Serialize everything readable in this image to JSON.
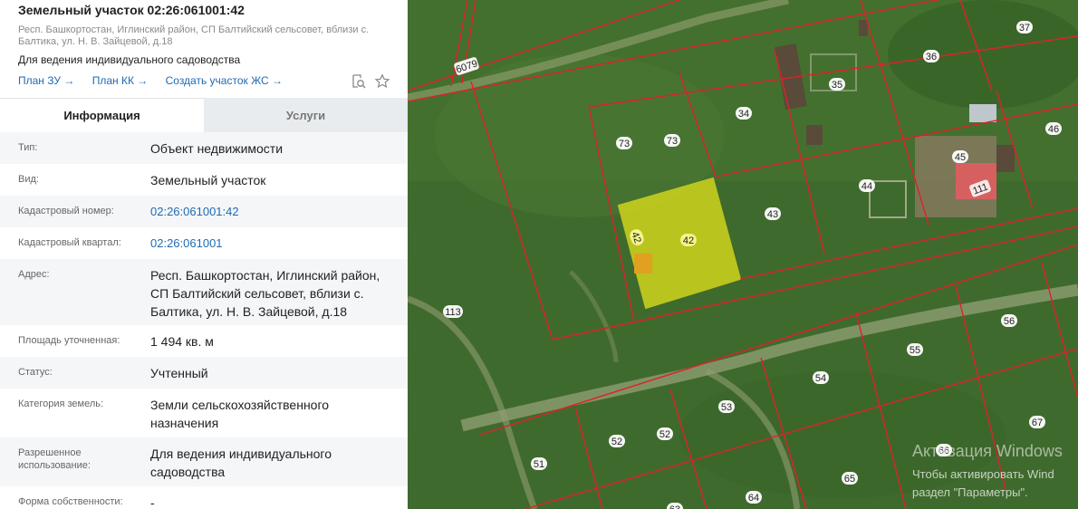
{
  "header": {
    "title": "Земельный участок 02:26:061001:42",
    "address_line": "Респ. Башкортостан, Иглинский район, СП Балтийский сельсовет, вблизи с. Балтика, ул. Н. В. Зайцевой, д.18",
    "purpose": "Для ведения индивидуального садоводства",
    "links": [
      "План ЗУ →",
      "План КК →",
      "Создать участок ЖС →"
    ]
  },
  "tabs": [
    "Информация",
    "Услуги"
  ],
  "fields": [
    {
      "label": "Тип:",
      "value": "Объект недвижимости"
    },
    {
      "label": "Вид:",
      "value": "Земельный участок"
    },
    {
      "label": "Кадастровый номер:",
      "value": "02:26:061001:42"
    },
    {
      "label": "Кадастровый квартал:",
      "value": "02:26:061001"
    },
    {
      "label": "Адрес:",
      "value": "Респ. Башкортостан, Иглинский район, СП Балтийский сельсовет, вблизи с. Балтика, ул. Н. В. Зайцевой, д.18"
    },
    {
      "label": "Площадь уточненная:",
      "value": "1 494 кв. м"
    },
    {
      "label": "Статус:",
      "value": "Учтенный"
    },
    {
      "label": "Категория земель:",
      "value": "Земли сельскохозяйственного назначения"
    },
    {
      "label": "Разрешенное использование:",
      "value": "Для ведения индивидуального садоводства"
    },
    {
      "label": "Форма собственности:",
      "value": "-"
    }
  ],
  "map": {
    "parcel_labels": [
      "6079",
      "37",
      "36",
      "35",
      "34",
      "73",
      "73",
      "46",
      "45",
      "111",
      "44",
      "43",
      "42",
      "42",
      "113",
      "56",
      "55",
      "54",
      "53",
      "52",
      "52",
      "51",
      "67",
      "66",
      "65",
      "64",
      "63"
    ],
    "selected_color": "#e2e21a",
    "boundary_color": "#e0202a"
  },
  "watermark": {
    "line1": "Активация Windows",
    "line2": "Чтобы активировать Wind",
    "line3": "раздел \"Параметры\"."
  }
}
